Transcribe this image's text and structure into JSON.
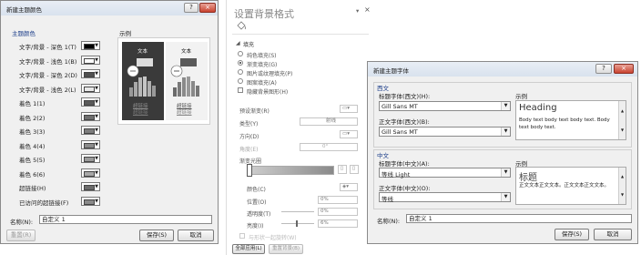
{
  "dialog1": {
    "title": "新建主题颜色",
    "help": "?",
    "close": "×",
    "theme_colors_label": "主题颜色",
    "sample_label": "示例",
    "items": [
      {
        "label": "文字/背景 - 深色 1(T)",
        "color": "#000000"
      },
      {
        "label": "文字/背景 - 浅色 1(B)",
        "color": "#ffffff"
      },
      {
        "label": "文字/背景 - 深色 2(D)",
        "color": "#505050"
      },
      {
        "label": "文字/背景 - 浅色 2(L)",
        "color": "#e8e8e8"
      },
      {
        "label": "着色 1(1)",
        "color": "#5a5a5a"
      },
      {
        "label": "着色 2(2)",
        "color": "#6e6e6e"
      },
      {
        "label": "着色 3(3)",
        "color": "#7d7d7d"
      },
      {
        "label": "着色 4(4)",
        "color": "#8c8c8c"
      },
      {
        "label": "着色 5(5)",
        "color": "#9a9a9a"
      },
      {
        "label": "着色 6(6)",
        "color": "#a8a8a8"
      },
      {
        "label": "超链接(H)",
        "color": "#6a6a6a"
      },
      {
        "label": "已访问的超链接(F)",
        "color": "#8a8a8a"
      }
    ],
    "sample": {
      "dark_text": "文本",
      "light_text": "文本",
      "hyperlink": "超链接",
      "visited": "超链接"
    },
    "name_label": "名称(N):",
    "name_value": "自定义 1",
    "reset_button": "重置(R)",
    "save_button": "保存(S)",
    "cancel_button": "取消"
  },
  "pane": {
    "title": "设置背景格式",
    "collapse": "▾",
    "close": "×",
    "section_fill": "填充",
    "options": [
      {
        "label": "纯色填充(S)",
        "selected": false
      },
      {
        "label": "渐变填充(G)",
        "selected": true
      },
      {
        "label": "图片或纹理填充(P)",
        "selected": false
      },
      {
        "label": "图案填充(A)",
        "selected": false
      }
    ],
    "hide_bg_label": "隐藏背景图形(H)",
    "preset_label": "预设渐变(R)",
    "type_label": "类型(Y)",
    "type_value": "射线",
    "direction_label": "方向(D)",
    "angle_label": "角度(E)",
    "angle_value": "0°",
    "stops_label": "渐变光圈",
    "color_label": "颜色(C)",
    "position_label": "位置(O)",
    "position_value": "0%",
    "transparency_label": "透明度(T)",
    "transparency_value": "0%",
    "brightness_label": "亮度(I)",
    "brightness_value": "6%",
    "rotate_label": "与形状一起旋转(W)",
    "apply_all_button": "全部应用(L)",
    "reset_bg_button": "重置背景(B)"
  },
  "dialog2": {
    "title": "新建主题字体",
    "help": "?",
    "close": "×",
    "western_section": "西文",
    "heading_font_label": "标题字体(西文)(H):",
    "heading_font_value": "Gill Sans MT",
    "body_font_label": "正文字体(西文)(B):",
    "body_font_value": "Gill Sans MT",
    "sample_label": "示例",
    "sample_heading": "Heading",
    "sample_body": "Body text body text body text. Body text body text.",
    "chinese_section": "中文",
    "heading_font_cn_label": "标题字体(中文)(A):",
    "heading_font_cn_value": "等线 Light",
    "body_font_cn_label": "正文字体(中文)(O):",
    "body_font_cn_value": "等线",
    "sample_cn_label": "示例",
    "sample_cn_heading": "标题",
    "sample_cn_body": "正文文本正文文本。正文文本正文文本。",
    "name_label": "名称(N):",
    "name_value": "自定义 1",
    "save_button": "保存(S)",
    "cancel_button": "取消"
  }
}
